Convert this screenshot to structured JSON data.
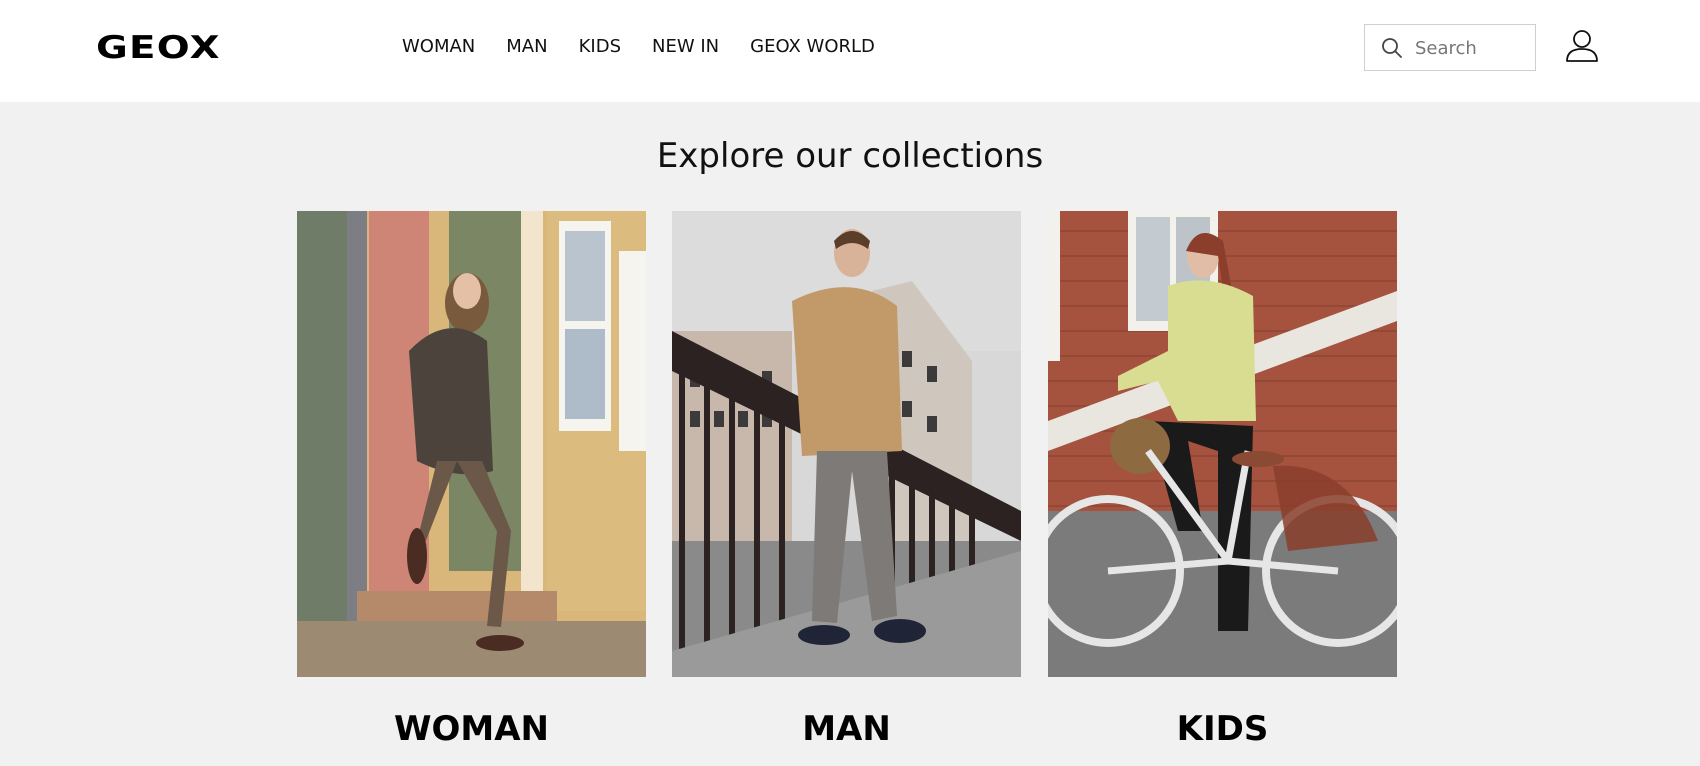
{
  "header": {
    "logo_text": "GEOX",
    "nav": [
      "WOMAN",
      "MAN",
      "KIDS",
      "NEW IN",
      "GEOX WORLD"
    ],
    "search": {
      "placeholder": "Search",
      "value": ""
    },
    "account_icon": "user-icon"
  },
  "main": {
    "title": "Explore our collections",
    "collections": [
      {
        "label": "WOMAN"
      },
      {
        "label": "MAN"
      },
      {
        "label": "KIDS"
      }
    ]
  },
  "colors": {
    "header_bg": "#ffffff",
    "page_bg": "#f1f1f1",
    "text": "#111111",
    "search_border": "#cfcfcf"
  }
}
